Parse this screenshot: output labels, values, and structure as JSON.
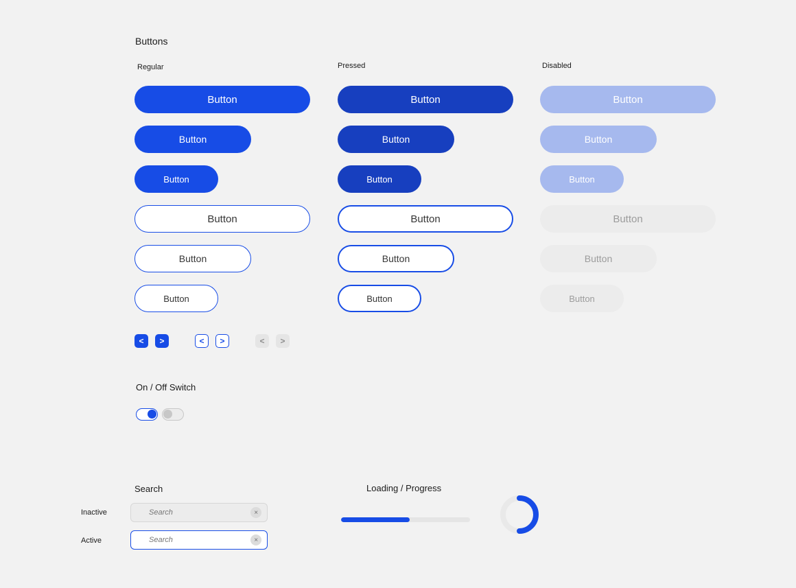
{
  "sections": {
    "buttons_title": "Buttons",
    "switch_title": "On / Off Switch",
    "search_title": "Search",
    "loading_title": "Loading / Progress"
  },
  "columns": {
    "regular": "Regular",
    "pressed": "Pressed",
    "disabled": "Disabled"
  },
  "buttons": {
    "regular": {
      "fill_lg": "Button",
      "fill_md": "Button",
      "fill_sm": "Button",
      "out_lg": "Button",
      "out_md": "Button",
      "out_sm": "Button"
    },
    "pressed": {
      "fill_lg": "Button",
      "fill_md": "Button",
      "fill_sm": "Button",
      "out_lg": "Button",
      "out_md": "Button",
      "out_sm": "Button"
    },
    "disabled": {
      "fill_lg": "Button",
      "fill_md": "Button",
      "fill_sm": "Button",
      "out_lg": "Button",
      "out_md": "Button",
      "out_sm": "Button"
    }
  },
  "arrows": {
    "prev_glyph": "<",
    "next_glyph": ">"
  },
  "search": {
    "inactive_label": "Inactive",
    "active_label": "Active",
    "placeholder": "Search"
  },
  "progress": {
    "percent": 53
  },
  "colors": {
    "primary": "#174ce6",
    "primary_pressed": "#173fbf",
    "primary_disabled": "#a6b9ee",
    "grey_bg": "#ececec",
    "grey_text": "#9c9c9c"
  }
}
